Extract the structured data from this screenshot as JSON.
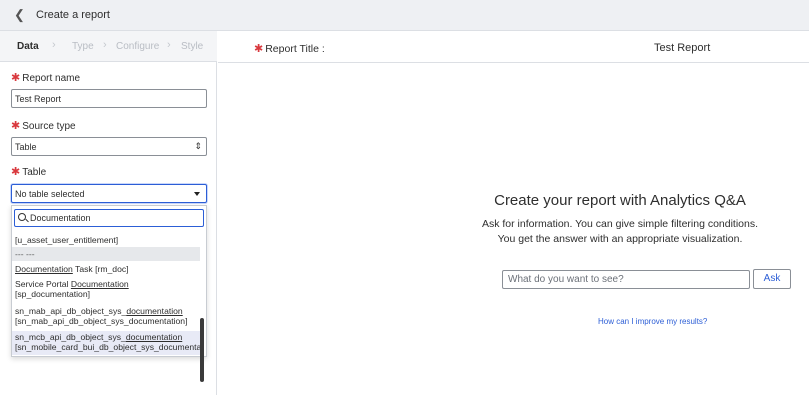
{
  "header": {
    "back_icon": "chevron-left-icon",
    "title": "Create a report"
  },
  "steps": [
    "Data",
    "Type",
    "Configure",
    "Style"
  ],
  "form": {
    "report_name_label": "Report name",
    "report_name_value": "Test Report",
    "source_type_label": "Source type",
    "source_type_value": "Table",
    "table_label": "Table",
    "table_value": "No table selected",
    "required_mark": "✱"
  },
  "dropdown": {
    "search_value": "Documentation",
    "items": {
      "i0": "[u_asset_user_entitlement]",
      "sep": "--- ---",
      "i1a": "Documentation",
      "i1b": " Task [rm_doc]",
      "i2a": "Service Portal ",
      "i2b": "Documentation",
      "i2c": "[sp_documentation]",
      "i3a": "sn_mab_api_db_object_sys_",
      "i3b": "documentation",
      "i3c": "[sn_mab_api_db_object_sys_documentation]",
      "i4a": "sn_mcb_api_db_object_sys_",
      "i4b": "documentation",
      "i4c": "[sn_mobile_card_bui_db_object_sys_documentati"
    }
  },
  "report": {
    "title_label": "Report Title :",
    "title_value": "Test Report"
  },
  "qa": {
    "heading": "Create your report with Analytics Q&A",
    "sub1": "Ask for information. You can give simple filtering conditions.",
    "sub2": "You get the answer with an appropriate visualization.",
    "input_placeholder": "What do you want to see?",
    "ask_label": "Ask",
    "improve_link": "How can I improve my results?"
  }
}
